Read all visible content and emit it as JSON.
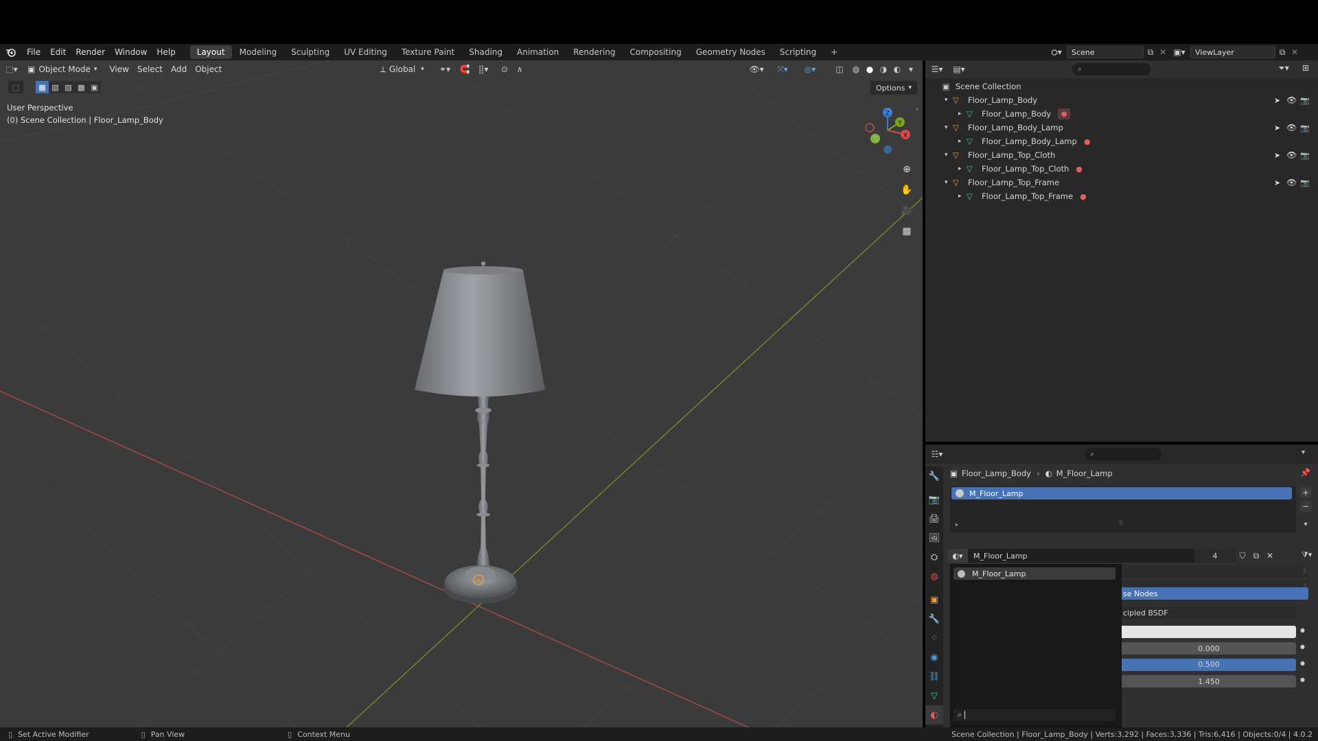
{
  "topbar": {
    "menus": [
      "File",
      "Edit",
      "Render",
      "Window",
      "Help"
    ],
    "workspaces": [
      "Layout",
      "Modeling",
      "Sculpting",
      "UV Editing",
      "Texture Paint",
      "Shading",
      "Animation",
      "Rendering",
      "Compositing",
      "Geometry Nodes",
      "Scripting"
    ],
    "active_workspace": "Layout",
    "add_tab": "+",
    "scene_name": "Scene",
    "view_layer": "ViewLayer"
  },
  "viewport": {
    "mode": "Object Mode",
    "menus": [
      "View",
      "Select",
      "Add",
      "Object"
    ],
    "transform_orientation": "Global",
    "options_label": "Options",
    "overlay_title": "User Perspective",
    "overlay_subtitle": "(0) Scene Collection | Floor_Lamp_Body",
    "gizmo_labels": {
      "z": "Z",
      "y": "Y",
      "x": "X"
    }
  },
  "outliner": {
    "root": "Scene Collection",
    "items": [
      {
        "name": "Floor_Lamp_Body",
        "child": "Floor_Lamp_Body"
      },
      {
        "name": "Floor_Lamp_Body_Lamp",
        "child": "Floor_Lamp_Body_Lamp"
      },
      {
        "name": "Floor_Lamp_Top_Cloth",
        "child": "Floor_Lamp_Top_Cloth"
      },
      {
        "name": "Floor_Lamp_Top_Frame",
        "child": "Floor_Lamp_Top_Frame"
      }
    ]
  },
  "properties": {
    "breadcrumb_object": "Floor_Lamp_Body",
    "breadcrumb_material": "M_Floor_Lamp",
    "slot_name": "M_Floor_Lamp",
    "material_name": "M_Floor_Lamp",
    "user_count": "4",
    "dropdown_item": "M_Floor_Lamp",
    "use_nodes_partial": "se Nodes",
    "surface_partial": "cipled BSDF",
    "values": [
      "0.000",
      "0.500",
      "1.450"
    ]
  },
  "statusbar": {
    "left": "Set Active Modifier",
    "middle": "Pan View",
    "right": "Context Menu",
    "stats": "Scene Collection | Floor_Lamp_Body | Verts:3,292 | Faces:3,336 | Tris:6,416 | Objects:0/4 | 4.0.2"
  },
  "colors": {
    "accent": "#4772b3",
    "x_axis": "#d84b4b",
    "y_axis": "#7aa31f",
    "z_axis": "#3f7fd6"
  }
}
